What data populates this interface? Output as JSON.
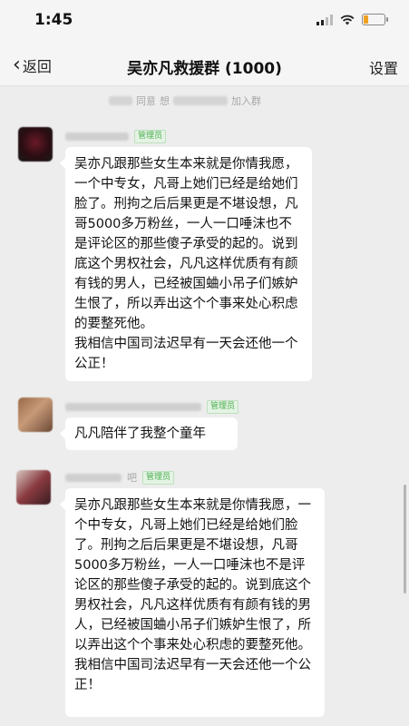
{
  "status_bar": {
    "time": "1:45"
  },
  "nav": {
    "back_label": "返回",
    "title": "吴亦凡救援群 (1000)",
    "settings_label": "设置"
  },
  "system_message": {
    "text_1": "同意",
    "text_2": "想",
    "text_3": "加入群"
  },
  "messages": [
    {
      "badge": "管理员",
      "text_1": "吴亦凡跟那些女生本来就是你情我愿，一个中专女，凡哥上她们已经是给她们脸了。刑拘之后后果更是不堪设想，凡哥5000多万粉丝，一人一口唾沫也不是评论区的那些傻子承受的起的。说到底这个男权社会，凡凡这样优质有有颜有钱的男人，已经被国蛐小吊子们嫉妒生恨了，所以弄出这个个事来处心积虑的要整死他。",
      "text_2": "我相信中国司法迟早有一天会还他一个公正！"
    },
    {
      "badge": "管理员",
      "text_1": "凡凡陪伴了我整个童年"
    },
    {
      "badge": "管理员",
      "name_fragment": "吧",
      "text_1": "吴亦凡跟那些女生本来就是你情我愿，一个中专女，凡哥上她们已经是给她们脸了。刑拘之后后果更是不堪设想，凡哥5000多万粉丝，一人一口唾沫也不是评论区的那些傻子承受的起的。说到底这个男权社会，凡凡这样优质有有颜有钱的男人，已经被国蛐小吊子们嫉妒生恨了，所以弄出这个个事来处心积虑的要整死他。",
      "text_2": "我相信中国司法迟早有一天会还他一个公正！"
    }
  ],
  "colors": {
    "background": "#ededed",
    "bubble": "#ffffff",
    "admin_badge": "#4caf50"
  },
  "icons": [
    "chevron-left-icon",
    "signal-icon",
    "wifi-icon",
    "battery-icon"
  ]
}
